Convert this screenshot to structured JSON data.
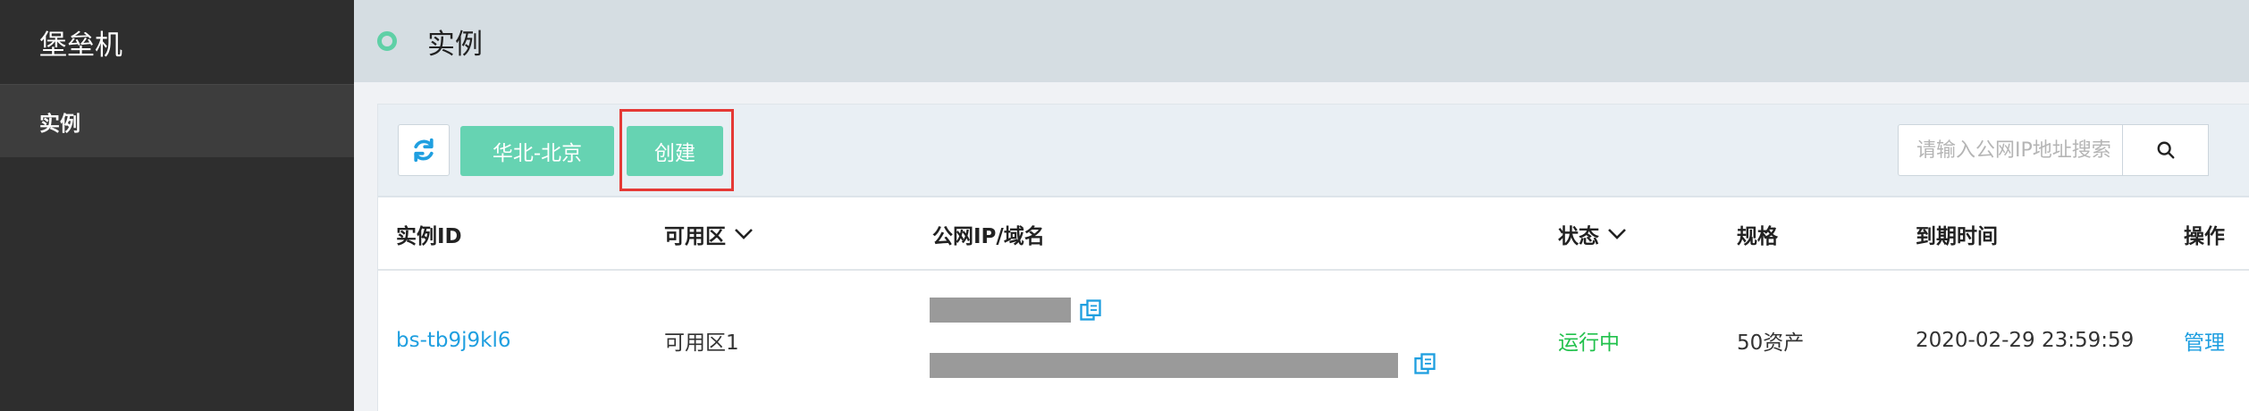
{
  "sidebar": {
    "title": "堡垒机",
    "items": [
      {
        "label": "实例"
      }
    ]
  },
  "topbar": {
    "title": "实例"
  },
  "toolbar": {
    "region_label": "华北-北京",
    "create_label": "创建",
    "search_placeholder": "请输入公网IP地址搜索"
  },
  "table": {
    "columns": [
      {
        "label": "实例ID"
      },
      {
        "label": "可用区"
      },
      {
        "label": "公网IP/域名"
      },
      {
        "label": "状态"
      },
      {
        "label": "规格"
      },
      {
        "label": "到期时间"
      },
      {
        "label": "操作"
      }
    ],
    "rows": [
      {
        "id": "bs-tb9j9kl6",
        "zone": "可用区1",
        "status": "运行中",
        "spec": "50资产",
        "expire": "2020-02-29 23:59:59",
        "action": "管理"
      }
    ]
  },
  "colors": {
    "accent": "#66d3b2",
    "link": "#1f9fe0",
    "status_running": "#21c14c",
    "highlight": "#e53935"
  }
}
